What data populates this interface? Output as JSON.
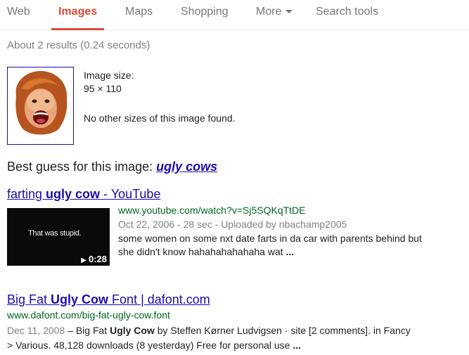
{
  "nav": {
    "tabs": [
      {
        "label": "Web"
      },
      {
        "label": "Images"
      },
      {
        "label": "Maps"
      },
      {
        "label": "Shopping"
      },
      {
        "label": "More"
      },
      {
        "label": "Search tools"
      }
    ],
    "active": "Images"
  },
  "stats": "About 2 results (0.24 seconds)",
  "image_info": {
    "size_label": "Image size:",
    "size_value": "95 × 110",
    "no_other": "No other sizes of this image found."
  },
  "best_guess": {
    "prefix": "Best guess for this image:",
    "query": "ugly cows"
  },
  "results": [
    {
      "title_pre": "farting ",
      "title_bold": "ugly cow",
      "title_post": " - YouTube",
      "url": "www.youtube.com/watch?v=Sj5SQKqTtDE",
      "meta": "Oct 22, 2006 - 28 sec - Uploaded by nbachamp2005",
      "snippet_line1": "some women on some nxt date farts in da car with parents behind but",
      "snippet_line2": "she didn't know hahahahahahaha wat",
      "ellipsis": "...",
      "thumb_text": "That was stupid.",
      "duration": "0:28"
    },
    {
      "title_pre": "Big Fat ",
      "title_bold": "Ugly Cow",
      "title_post": " Font | dafont.com",
      "url": "www.dafont.com/big-fat-ugly-cow.font",
      "date": "Dec 11, 2008",
      "dash": " – ",
      "snip_a": "Big Fat ",
      "snip_bold": "Ugly Cow",
      "snip_b": " by Steffen Kørner Ludvigsen · site [2 comments]. in Fancy",
      "snippet_line2": "> Various. 48,128 downloads (8 yesterday) Free for personal use",
      "ellipsis": "..."
    }
  ],
  "colors": {
    "link": "#1a0dab",
    "url": "#006621",
    "active_tab": "#dd4b39",
    "muted": "#808080"
  },
  "icons": {
    "more_caret": "chevron-down-icon",
    "play": "play-icon"
  }
}
